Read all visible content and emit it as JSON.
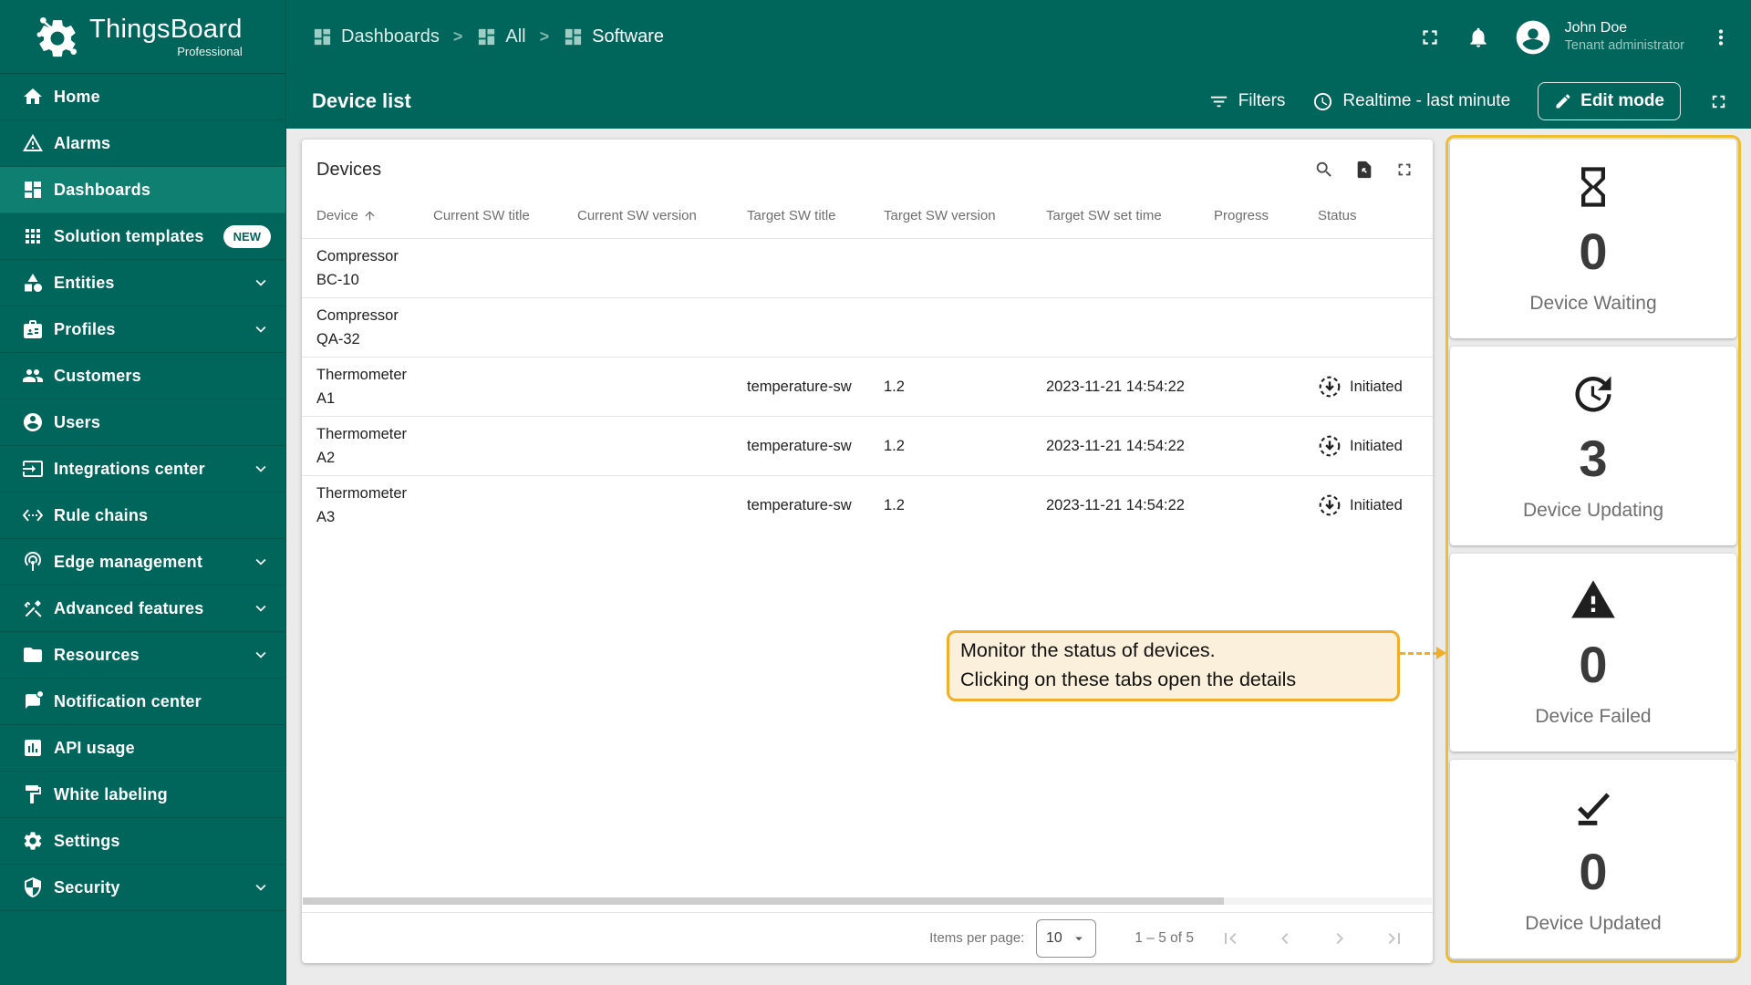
{
  "brand": {
    "name": "ThingsBoard",
    "subtitle": "Professional"
  },
  "sidebar": {
    "items": [
      {
        "label": "Home"
      },
      {
        "label": "Alarms"
      },
      {
        "label": "Dashboards",
        "selected": true
      },
      {
        "label": "Solution templates",
        "badge": "NEW"
      },
      {
        "label": "Entities",
        "expandable": true
      },
      {
        "label": "Profiles",
        "expandable": true
      },
      {
        "label": "Customers"
      },
      {
        "label": "Users"
      },
      {
        "label": "Integrations center",
        "expandable": true
      },
      {
        "label": "Rule chains"
      },
      {
        "label": "Edge management",
        "expandable": true
      },
      {
        "label": "Advanced features",
        "expandable": true
      },
      {
        "label": "Resources",
        "expandable": true
      },
      {
        "label": "Notification center"
      },
      {
        "label": "API usage"
      },
      {
        "label": "White labeling"
      },
      {
        "label": "Settings"
      },
      {
        "label": "Security",
        "expandable": true
      }
    ]
  },
  "header": {
    "breadcrumb": [
      {
        "label": "Dashboards"
      },
      {
        "label": "All"
      },
      {
        "label": "Software"
      }
    ],
    "separator": ">",
    "user": {
      "name": "John Doe",
      "role": "Tenant administrator"
    }
  },
  "toolbar": {
    "title": "Device list",
    "filters_label": "Filters",
    "time_label": "Realtime - last minute",
    "edit_label": "Edit mode"
  },
  "table": {
    "title": "Devices",
    "columns": [
      "Device",
      "Current SW title",
      "Current SW version",
      "Target SW title",
      "Target SW version",
      "Target SW set time",
      "Progress",
      "Status"
    ],
    "rows": [
      {
        "device1": "Compressor",
        "device2": "BC-10",
        "current_sw_title": "",
        "current_sw_version": "",
        "target_sw_title": "",
        "target_sw_version": "",
        "target_sw_set_time": "",
        "progress": "",
        "status": ""
      },
      {
        "device1": "Compressor",
        "device2": "QA-32",
        "current_sw_title": "",
        "current_sw_version": "",
        "target_sw_title": "",
        "target_sw_version": "",
        "target_sw_set_time": "",
        "progress": "",
        "status": ""
      },
      {
        "device1": "Thermometer",
        "device2": "A1",
        "current_sw_title": "",
        "current_sw_version": "",
        "target_sw_title": "temperature-sw",
        "target_sw_version": "1.2",
        "target_sw_set_time": "2023-11-21 14:54:22",
        "progress": "",
        "status": "Initiated"
      },
      {
        "device1": "Thermometer",
        "device2": "A2",
        "current_sw_title": "",
        "current_sw_version": "",
        "target_sw_title": "temperature-sw",
        "target_sw_version": "1.2",
        "target_sw_set_time": "2023-11-21 14:54:22",
        "progress": "",
        "status": "Initiated"
      },
      {
        "device1": "Thermometer",
        "device2": "A3",
        "current_sw_title": "",
        "current_sw_version": "",
        "target_sw_title": "temperature-sw",
        "target_sw_version": "1.2",
        "target_sw_set_time": "2023-11-21 14:54:22",
        "progress": "",
        "status": "Initiated"
      }
    ]
  },
  "pagination": {
    "items_per_page_label": "Items per page:",
    "items_per_page_value": "10",
    "range": "1 – 5 of 5"
  },
  "status_cards": [
    {
      "icon": "hourglass-icon",
      "value": "0",
      "label": "Device Waiting"
    },
    {
      "icon": "update-icon",
      "value": "3",
      "label": "Device Updating"
    },
    {
      "icon": "warning-icon",
      "value": "0",
      "label": "Device Failed"
    },
    {
      "icon": "check-icon",
      "value": "0",
      "label": "Device Updated"
    }
  ],
  "annotation": {
    "line1": "Monitor the status of devices.",
    "line2": "Clicking on these tabs open the details"
  },
  "colors": {
    "teal": "#00655A",
    "teal_selected": "#0E7F70",
    "highlight_border": "#F0BF2F",
    "annotation_bg": "#FAF0DC",
    "annotation_border": "#F0AE2B"
  }
}
